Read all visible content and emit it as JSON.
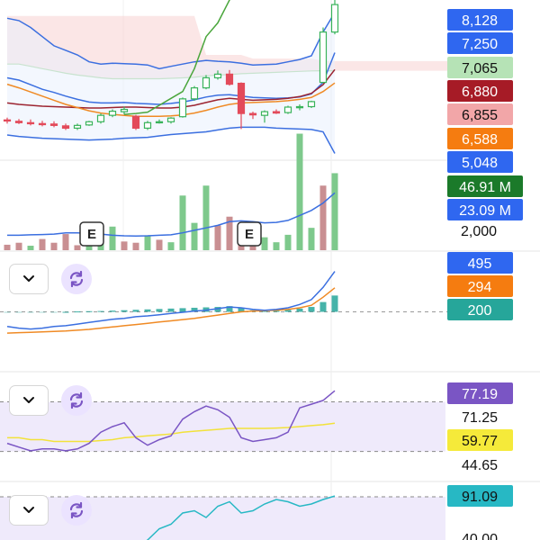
{
  "colors": {
    "up": "#39b35a",
    "down": "#e34a5a",
    "vol_up": "#7ec98c",
    "vol_down": "#c98f92",
    "bb": "#3b6fe0",
    "ma_orange": "#f08a24",
    "ma_darkred": "#9c2430",
    "ma_green": "#4aa63c",
    "cloud": "#f7d2d2",
    "rsi": "#7a55c4",
    "rsi_ma": "#f2e23a",
    "stoch": "#27b8c4",
    "macd_blue": "#3b6fe0",
    "macd_orange": "#f08a24",
    "macd_hist": "#26a69a",
    "band": "#efeafb"
  },
  "icons": {
    "dropdown": "chevron-down-icon",
    "refresh": "refresh-icon"
  },
  "markers": [
    "E",
    "E"
  ],
  "price_labels": [
    {
      "text": "8,128",
      "bg": "#2f67f0",
      "fg": "#ffffff"
    },
    {
      "text": "7,250",
      "bg": "#2f67f0",
      "fg": "#ffffff"
    },
    {
      "text": "7,065",
      "bg": "#b6e3b6",
      "fg": "#111111"
    },
    {
      "text": "6,880",
      "bg": "#a61b26",
      "fg": "#ffffff"
    },
    {
      "text": "6,855",
      "bg": "#f2a6a8",
      "fg": "#111111"
    },
    {
      "text": "6,588",
      "bg": "#f57c10",
      "fg": "#ffffff"
    },
    {
      "text": "5,048",
      "bg": "#2f67f0",
      "fg": "#ffffff"
    }
  ],
  "volume_labels": [
    {
      "text": "46.91 M",
      "bg": "#1b7a2a",
      "fg": "#ffffff"
    },
    {
      "text": "23.09 M",
      "bg": "#2f67f0",
      "fg": "#ffffff"
    },
    {
      "text": "2,000",
      "bg": "",
      "fg": "#111111"
    }
  ],
  "macd_labels": [
    {
      "text": "495",
      "bg": "#2f67f0",
      "fg": "#ffffff"
    },
    {
      "text": "294",
      "bg": "#f57c10",
      "fg": "#ffffff"
    },
    {
      "text": "200",
      "bg": "#26a69a",
      "fg": "#ffffff"
    }
  ],
  "rsi_labels": [
    {
      "text": "77.19",
      "bg": "#7a55c4",
      "fg": "#ffffff"
    },
    {
      "text": "71.25",
      "bg": "",
      "fg": "#111111"
    },
    {
      "text": "59.77",
      "bg": "#f5ea3a",
      "fg": "#111111"
    },
    {
      "text": "44.65",
      "bg": "",
      "fg": "#111111"
    }
  ],
  "stoch_labels": [
    {
      "text": "91.09",
      "bg": "#27b8c4",
      "fg": "#111111"
    },
    {
      "text": "40.00",
      "bg": "",
      "fg": "#111111"
    }
  ],
  "chart_data": {
    "type": "line",
    "n": 29,
    "panels": {
      "price": {
        "ylim": [
          4900,
          8400
        ],
        "candles": [
          {
            "o": 5780,
            "h": 5830,
            "l": 5700,
            "c": 5760
          },
          {
            "o": 5750,
            "h": 5800,
            "l": 5690,
            "c": 5720
          },
          {
            "o": 5720,
            "h": 5790,
            "l": 5660,
            "c": 5700
          },
          {
            "o": 5700,
            "h": 5760,
            "l": 5640,
            "c": 5680
          },
          {
            "o": 5690,
            "h": 5750,
            "l": 5620,
            "c": 5660
          },
          {
            "o": 5650,
            "h": 5700,
            "l": 5560,
            "c": 5600
          },
          {
            "o": 5600,
            "h": 5700,
            "l": 5560,
            "c": 5660
          },
          {
            "o": 5670,
            "h": 5760,
            "l": 5650,
            "c": 5740
          },
          {
            "o": 5740,
            "h": 5920,
            "l": 5700,
            "c": 5880
          },
          {
            "o": 5880,
            "h": 6010,
            "l": 5840,
            "c": 5970
          },
          {
            "o": 5960,
            "h": 6070,
            "l": 5900,
            "c": 6010
          },
          {
            "o": 5860,
            "h": 5890,
            "l": 5560,
            "c": 5600
          },
          {
            "o": 5600,
            "h": 5760,
            "l": 5560,
            "c": 5720
          },
          {
            "o": 5720,
            "h": 5790,
            "l": 5700,
            "c": 5740
          },
          {
            "o": 5740,
            "h": 5840,
            "l": 5700,
            "c": 5820
          },
          {
            "o": 5850,
            "h": 6270,
            "l": 5830,
            "c": 6240
          },
          {
            "o": 6240,
            "h": 6520,
            "l": 6200,
            "c": 6480
          },
          {
            "o": 6480,
            "h": 6760,
            "l": 6450,
            "c": 6700
          },
          {
            "o": 6700,
            "h": 6860,
            "l": 6660,
            "c": 6780
          },
          {
            "o": 6780,
            "h": 6870,
            "l": 6530,
            "c": 6560
          },
          {
            "o": 6580,
            "h": 6600,
            "l": 5580,
            "c": 5920
          },
          {
            "o": 5920,
            "h": 5960,
            "l": 5800,
            "c": 5890
          },
          {
            "o": 5880,
            "h": 5990,
            "l": 5720,
            "c": 5960
          },
          {
            "o": 5960,
            "h": 6010,
            "l": 5910,
            "c": 5930
          },
          {
            "o": 5940,
            "h": 6090,
            "l": 5910,
            "c": 6060
          },
          {
            "o": 6060,
            "h": 6120,
            "l": 5990,
            "c": 6070
          },
          {
            "o": 6070,
            "h": 6200,
            "l": 6040,
            "c": 6180
          },
          {
            "o": 6600,
            "h": 7800,
            "l": 6580,
            "c": 7700
          },
          {
            "o": 7700,
            "h": 8400,
            "l": 7650,
            "c": 8300
          }
        ],
        "series": [
          {
            "name": "BB-Upper",
            "color": "#3b6fe0",
            "values": [
              8000,
              7950,
              7800,
              7600,
              7400,
              7300,
              7200,
              7050,
              7000,
              7020,
              7010,
              7000,
              6980,
              6900,
              6950,
              7000,
              7050,
              7080,
              7060,
              7050,
              7020,
              6980,
              6990,
              7000,
              7050,
              7100,
              7180,
              7700,
              8128
            ]
          },
          {
            "name": "BB-Lower",
            "color": "#3b6fe0",
            "values": [
              5450,
              5420,
              5400,
              5380,
              5370,
              5360,
              5350,
              5340,
              5350,
              5360,
              5380,
              5390,
              5400,
              5430,
              5460,
              5480,
              5500,
              5520,
              5560,
              5600,
              5620,
              5620,
              5620,
              5600,
              5590,
              5580,
              5570,
              5520,
              5048
            ]
          },
          {
            "name": "BB-Mid",
            "color": "#3b6fe0",
            "values": [
              6700,
              6650,
              6550,
              6450,
              6380,
              6300,
              6230,
              6170,
              6150,
              6150,
              6160,
              6140,
              6130,
              6120,
              6140,
              6170,
              6220,
              6280,
              6320,
              6330,
              6300,
              6270,
              6260,
              6250,
              6260,
              6280,
              6350,
              6600,
              7250
            ]
          },
          {
            "name": "MA-Orange",
            "color": "#f08a24",
            "values": [
              6560,
              6480,
              6390,
              6300,
              6210,
              6120,
              6050,
              5980,
              5930,
              5900,
              5880,
              5860,
              5860,
              5860,
              5870,
              5890,
              5930,
              5990,
              6060,
              6120,
              6150,
              6160,
              6170,
              6180,
              6200,
              6230,
              6270,
              6400,
              6588
            ]
          },
          {
            "name": "MA-DarkRed",
            "color": "#9c2430",
            "values": [
              6150,
              6120,
              6100,
              6080,
              6070,
              6060,
              6050,
              6040,
              6040,
              6050,
              6060,
              6060,
              6050,
              6040,
              6040,
              6060,
              6100,
              6160,
              6220,
              6250,
              6230,
              6210,
              6220,
              6230,
              6250,
              6290,
              6360,
              6550,
              6880
            ]
          },
          {
            "name": "Ichimoku-Lagging",
            "color": "#4aa63c",
            "values": [
              null,
              null,
              null,
              null,
              null,
              null,
              null,
              null,
              null,
              null,
              5900,
              5920,
              5950,
              6100,
              6250,
              6400,
              6900,
              7600,
              7900,
              8400,
              8800,
              null,
              null,
              null,
              null,
              null,
              null,
              null,
              null
            ]
          },
          {
            "name": "Cloud-Top",
            "color": "#f7d2d2",
            "values": [
              8050,
              8050,
              8050,
              8050,
              8050,
              8050,
              8050,
              8050,
              8050,
              8050,
              8050,
              8050,
              8050,
              8050,
              8050,
              8050,
              8050,
              7200,
              7200,
              7200,
              7200,
              7120,
              7120,
              7120,
              7120,
              7120,
              7120,
              7070,
              7065
            ]
          },
          {
            "name": "Cloud-Bottom",
            "color": "#cfe5c8",
            "values": [
              7000,
              7000,
              6950,
              6900,
              6850,
              6800,
              6760,
              6730,
              6700,
              6680,
              6680,
              6680,
              6680,
              6680,
              6690,
              6700,
              6710,
              6740,
              6760,
              6770,
              6790,
              6800,
              6810,
              6820,
              6830,
              6840,
              6850,
              6855,
              6855
            ]
          }
        ]
      },
      "volume": {
        "ylim": [
          0,
          50
        ],
        "bars": [
          {
            "v": 2.2,
            "up": false
          },
          {
            "v": 3.0,
            "up": false
          },
          {
            "v": 1.8,
            "up": true
          },
          {
            "v": 4.5,
            "up": false
          },
          {
            "v": 3.0,
            "up": false
          },
          {
            "v": 6.5,
            "up": false
          },
          {
            "v": 2.0,
            "up": false
          },
          {
            "v": 4.0,
            "up": true
          },
          {
            "v": 5.8,
            "up": true
          },
          {
            "v": 9.5,
            "up": true
          },
          {
            "v": 3.5,
            "up": false
          },
          {
            "v": 3.0,
            "up": false
          },
          {
            "v": 6.0,
            "up": true
          },
          {
            "v": 4.2,
            "up": false
          },
          {
            "v": 3.2,
            "up": true
          },
          {
            "v": 22.0,
            "up": true
          },
          {
            "v": 11.0,
            "up": true
          },
          {
            "v": 26.0,
            "up": true
          },
          {
            "v": 10.0,
            "up": false
          },
          {
            "v": 13.5,
            "up": false
          },
          {
            "v": 10.5,
            "up": false
          },
          {
            "v": 2.8,
            "up": false
          },
          {
            "v": 5.2,
            "up": true
          },
          {
            "v": 3.2,
            "up": true
          },
          {
            "v": 6.2,
            "up": true
          },
          {
            "v": 46.91,
            "up": true
          },
          {
            "v": 9.0,
            "up": true
          },
          {
            "v": 26.0,
            "up": false
          },
          {
            "v": 31.0,
            "up": true
          }
        ],
        "avg": [
          6,
          6,
          6.2,
          6.3,
          6.5,
          7,
          7,
          6.8,
          6.5,
          6,
          5.8,
          5.7,
          5.8,
          6,
          6.2,
          7,
          8,
          9,
          10,
          11.5,
          11.8,
          11.5,
          11,
          11.2,
          12,
          14,
          16,
          19,
          23.09
        ]
      },
      "macd": {
        "ylim": [
          -700,
          700
        ],
        "macd": [
          -180,
          -200,
          -210,
          -200,
          -180,
          -170,
          -150,
          -130,
          -110,
          -90,
          -80,
          -60,
          -50,
          -35,
          -20,
          -5,
          10,
          20,
          40,
          60,
          50,
          30,
          20,
          30,
          50,
          90,
          150,
          300,
          495
        ],
        "signal": [
          -260,
          -255,
          -250,
          -245,
          -240,
          -235,
          -225,
          -215,
          -200,
          -185,
          -170,
          -155,
          -140,
          -125,
          -110,
          -95,
          -80,
          -60,
          -40,
          -20,
          0,
          10,
          15,
          20,
          30,
          50,
          80,
          180,
          294
        ],
        "hist": [
          -10,
          -10,
          -8,
          -5,
          -3,
          0,
          5,
          8,
          10,
          15,
          20,
          25,
          30,
          35,
          40,
          45,
          50,
          55,
          60,
          70,
          50,
          20,
          10,
          15,
          25,
          40,
          60,
          120,
          200
        ]
      },
      "rsi": {
        "ylim": [
          30,
          85
        ],
        "levels": [
          71.25,
          44.65
        ],
        "rsi": [
          49,
          47,
          45,
          46,
          46,
          45,
          46,
          49,
          55,
          58,
          60,
          52,
          48,
          51,
          53,
          62,
          66,
          69,
          67,
          63,
          52,
          50,
          51,
          52,
          55,
          68,
          70,
          72,
          77.19
        ],
        "ma": [
          52,
          52,
          51,
          51,
          50,
          50,
          50,
          50,
          50.5,
          51,
          52,
          52.5,
          53,
          53.5,
          54,
          55,
          55.5,
          56,
          56.5,
          57,
          57,
          57,
          57,
          57.2,
          57.5,
          58,
          58.5,
          59,
          59.77
        ]
      },
      "stoch": {
        "ylim": [
          20,
          100
        ],
        "level": 40.0,
        "values": [
          null,
          null,
          null,
          null,
          null,
          null,
          null,
          null,
          null,
          null,
          38,
          44,
          52,
          62,
          66,
          76,
          78,
          72,
          82,
          86,
          76,
          78,
          84,
          88,
          86,
          82,
          84,
          88,
          91.09
        ]
      }
    }
  }
}
